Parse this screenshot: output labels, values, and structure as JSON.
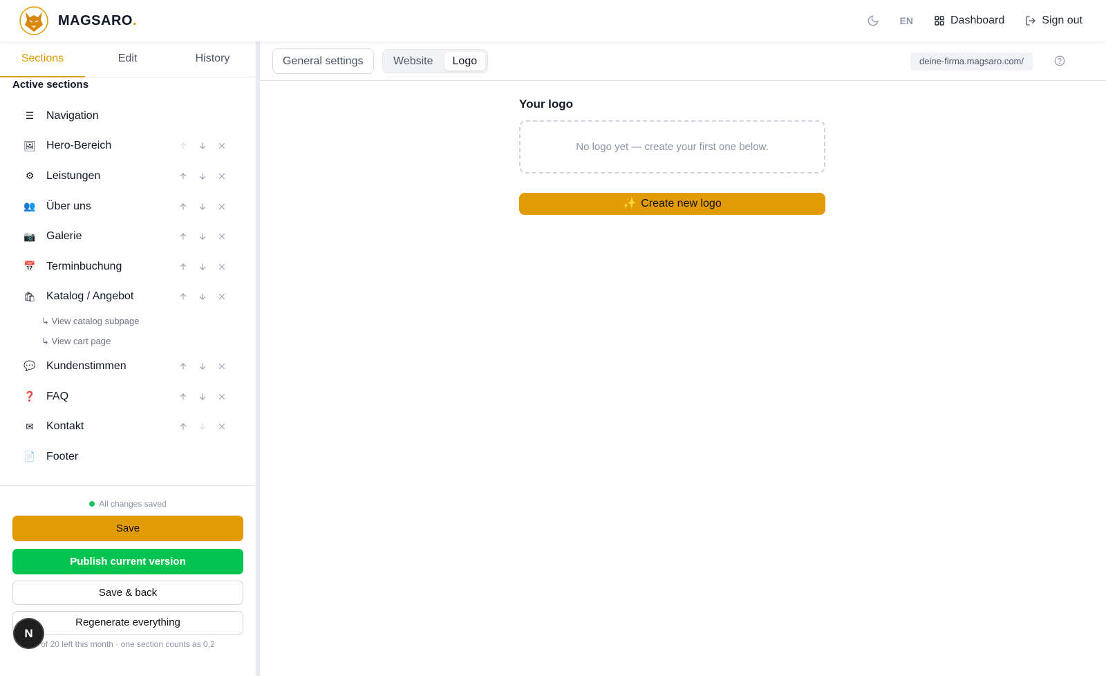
{
  "header": {
    "brand_name": "MAGSARO",
    "brand_dot": ".",
    "lang": "EN",
    "dashboard_label": "Dashboard",
    "signout_label": "Sign out"
  },
  "sidebar": {
    "tabs": [
      {
        "label": "Sections",
        "active": true
      },
      {
        "label": "Edit",
        "active": false
      },
      {
        "label": "History",
        "active": false
      }
    ],
    "heading": "Active sections",
    "sections": [
      {
        "label": "Navigation",
        "icon": "menu-icon",
        "glyph": "☰",
        "actions": false
      },
      {
        "label": "Hero-Bereich",
        "icon": "picture-icon",
        "glyph": "🖼",
        "actions": true,
        "up_disabled": true,
        "down_disabled": false
      },
      {
        "label": "Leistungen",
        "icon": "gear-icon",
        "glyph": "⚙",
        "actions": true,
        "up_disabled": false,
        "down_disabled": false
      },
      {
        "label": "Über uns",
        "icon": "people-icon",
        "glyph": "👥",
        "actions": true,
        "up_disabled": false,
        "down_disabled": false
      },
      {
        "label": "Galerie",
        "icon": "camera-icon",
        "glyph": "📷",
        "actions": true,
        "up_disabled": false,
        "down_disabled": false
      },
      {
        "label": "Terminbuchung",
        "icon": "calendar-icon",
        "glyph": "📅",
        "actions": true,
        "up_disabled": false,
        "down_disabled": false
      },
      {
        "label": "Katalog / Angebot",
        "icon": "shopping-bags-icon",
        "glyph": "🛍",
        "actions": true,
        "up_disabled": false,
        "down_disabled": false,
        "subs": [
          "↳ View catalog subpage",
          "↳ View cart page"
        ]
      },
      {
        "label": "Kundenstimmen",
        "icon": "speech-bubble-icon",
        "glyph": "💬",
        "actions": true,
        "up_disabled": false,
        "down_disabled": false
      },
      {
        "label": "FAQ",
        "icon": "question-mark-icon",
        "glyph": "❓",
        "actions": true,
        "up_disabled": false,
        "down_disabled": false
      },
      {
        "label": "Kontakt",
        "icon": "envelope-icon",
        "glyph": "✉",
        "actions": true,
        "up_disabled": false,
        "down_disabled": true
      },
      {
        "label": "Footer",
        "icon": "page-icon",
        "glyph": "📄",
        "actions": false
      }
    ],
    "saved_status": "All changes saved",
    "save_label": "Save",
    "publish_label": "Publish current version",
    "save_back_label": "Save & back",
    "regenerate_label": "Regenerate everything",
    "quota_text": "of 20 left this month · one section counts as 0,2",
    "badge_letter": "N"
  },
  "main": {
    "general_settings_label": "General settings",
    "seg_tabs": [
      {
        "label": "Website",
        "active": false
      },
      {
        "label": "Logo",
        "active": true
      }
    ],
    "domain": "deine-firma.magsaro.com/",
    "logo_title": "Your logo",
    "logo_empty": "No logo yet — create your first one below.",
    "create_label": "Create new logo",
    "create_icon": "✨"
  },
  "colors": {
    "accent": "#e29a05",
    "publish": "#00c44f",
    "saved_dot": "#16c45a"
  }
}
